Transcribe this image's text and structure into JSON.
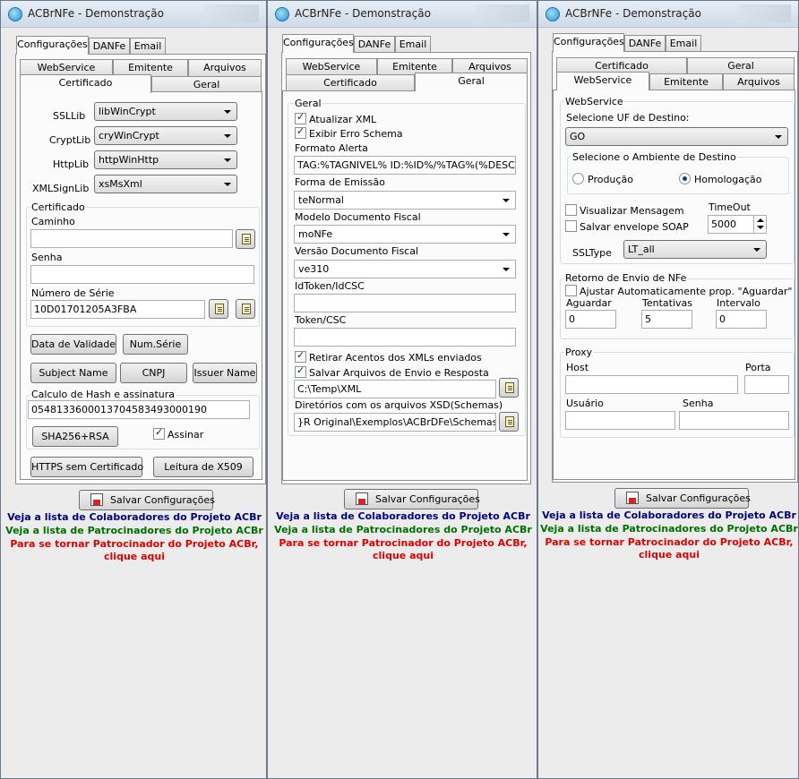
{
  "app_title": "ACBrNFe - Demonstração",
  "main_tabs": [
    "Configurações",
    "DANFe",
    "Email"
  ],
  "sub_tabs": {
    "webservice": "WebService",
    "emitente": "Emitente",
    "arquivos": "Arquivos",
    "certificado": "Certificado",
    "geral": "Geral"
  },
  "save_label": "Salvar Configurações",
  "links": {
    "colaboradores": "Veja a lista de Colaboradores do Projeto ACBr",
    "patrocinadores": "Veja a lista de Patrocinadores do Projeto ACBr",
    "tornar_line1": "Para se tornar Patrocinador do Projeto ACBr,",
    "tornar_line2": "clique aqui"
  },
  "colors": {
    "blue_link": "#000080",
    "green_link": "#007000",
    "red_link": "#e00000"
  },
  "window1": {
    "ssllib_label": "SSLLib",
    "ssllib_value": "libWinCrypt",
    "cryptlib_label": "CryptLib",
    "cryptlib_value": "cryWinCrypt",
    "httplib_label": "HttpLib",
    "httplib_value": "httpWinHttp",
    "xmlsign_label": "XMLSignLib",
    "xmlsign_value": "xsMsXml",
    "cert_group": "Certificado",
    "caminho_label": "Caminho",
    "caminho_value": "",
    "senha_label": "Senha",
    "senha_value": "",
    "serie_label": "Número de Série",
    "serie_value": "10D01701205A3FBA",
    "btn_validade": "Data de Validade",
    "btn_numserie": "Num.Série",
    "btn_subject": "Subject Name",
    "btn_cnpj": "CNPJ",
    "btn_issuer": "Issuer Name",
    "hash_group": "Calculo de Hash e assinatura",
    "hash_value": "0548133600013704583493000190",
    "btn_sha": "SHA256+RSA",
    "assinar_label": "Assinar",
    "btn_https": "HTTPS sem Certificado",
    "btn_leitura": "Leitura de X509"
  },
  "window2": {
    "group": "Geral",
    "atualizar_xml": "Atualizar XML",
    "exibir_erro": "Exibir Erro Schema",
    "formato_label": "Formato Alerta",
    "formato_value": "TAG:%TAGNIVEL% ID:%ID%/%TAG%(%DESCRICAO%)",
    "forma_emissao_label": "Forma de Emissão",
    "forma_emissao_value": "teNormal",
    "modelo_label": "Modelo Documento Fiscal",
    "modelo_value": "moNFe",
    "versao_label": "Versão Documento Fiscal",
    "versao_value": "ve310",
    "idtoken_label": "IdToken/IdCSC",
    "idtoken_value": "",
    "token_label": "Token/CSC",
    "token_value": "",
    "retirar_acentos": "Retirar Acentos dos XMLs enviados",
    "salvar_arquivos": "Salvar Arquivos de Envio e Resposta",
    "path_value": "C:\\Temp\\XML",
    "xsd_label": "Diretórios com os arquivos XSD(Schemas)",
    "xsd_value": "}R Original\\Exemplos\\ACBrDFe\\Schemas\\NFe"
  },
  "window3": {
    "ws_group": "WebService",
    "uf_label": "Selecione UF de Destino:",
    "uf_value": "GO",
    "ambiente_group": "Selecione o Ambiente de Destino",
    "producao": "Produção",
    "homologacao": "Homologação",
    "visualizar": "Visualizar Mensagem",
    "salvar_envelope": "Salvar envelope SOAP",
    "timeout_label": "TimeOut",
    "timeout_value": "5000",
    "ssltype_label": "SSLType",
    "ssltype_value": "LT_all",
    "retorno_group": "Retorno de Envio de NFe",
    "ajustar": "Ajustar Automaticamente prop. \"Aguardar\"",
    "aguardar_label": "Aguardar",
    "aguardar_value": "0",
    "tentativas_label": "Tentativas",
    "tentativas_value": "5",
    "intervalo_label": "Intervalo",
    "intervalo_value": "0",
    "proxy_group": "Proxy",
    "host_label": "Host",
    "host_value": "",
    "porta_label": "Porta",
    "porta_value": "",
    "usuario_label": "Usuário",
    "usuario_value": "",
    "senha_label": "Senha",
    "senha_value": ""
  }
}
